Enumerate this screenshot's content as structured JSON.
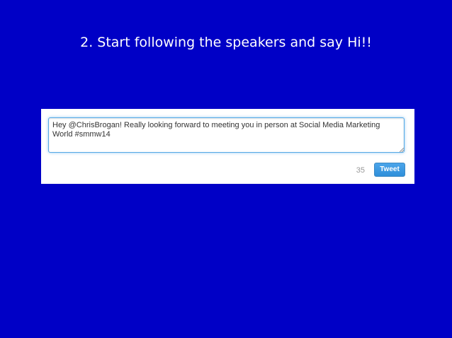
{
  "slide": {
    "title": "2. Start following the speakers and say Hi!!"
  },
  "tweet": {
    "text": "Hey @ChrisBrogan! Really looking forward to meeting you in person at Social Media Marketing World #smmw14",
    "chars_remaining": "35",
    "button_label": "Tweet"
  },
  "colors": {
    "background": "#0000c6",
    "title_text": "#ffffff",
    "button": "#3a9ae2"
  }
}
